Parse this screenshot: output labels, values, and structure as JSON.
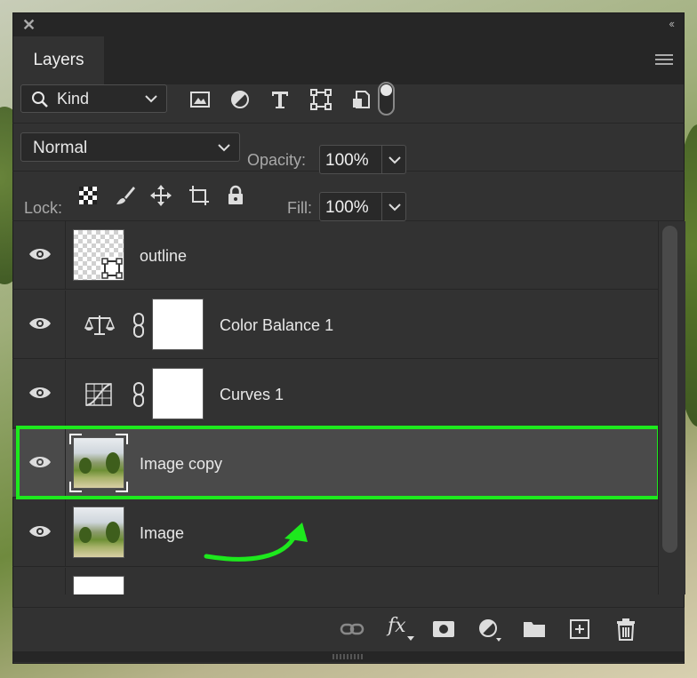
{
  "panel": {
    "close_glyph": "✕",
    "collapse_glyph": "‹‹",
    "tab_label": "Layers"
  },
  "filter": {
    "kind_label": "Kind",
    "icons": [
      "image-filter-icon",
      "adjustment-filter-icon",
      "type-filter-icon",
      "shape-filter-icon",
      "smart-object-filter-icon"
    ],
    "toggle_on": true
  },
  "blend": {
    "mode": "Normal",
    "opacity_label": "Opacity:",
    "opacity_value": "100%"
  },
  "lock": {
    "label": "Lock:",
    "fill_label": "Fill:",
    "fill_value": "100%"
  },
  "layers": [
    {
      "name": "outline",
      "type": "shape",
      "visible": true
    },
    {
      "name": "Color Balance 1",
      "type": "adjustment",
      "visible": true
    },
    {
      "name": "Curves 1",
      "type": "adjustment",
      "visible": true
    },
    {
      "name": "Image copy",
      "type": "image",
      "visible": true,
      "selected": true
    },
    {
      "name": "Image",
      "type": "image",
      "visible": true
    }
  ],
  "colors": {
    "panel_bg": "#323232",
    "selected_row": "#4a4a4a",
    "highlight": "#1de91d"
  },
  "bottom_icons": [
    "link-layers-icon",
    "fx-icon",
    "layer-mask-icon",
    "new-adjustment-icon",
    "new-group-icon",
    "new-layer-icon",
    "trash-icon"
  ],
  "fx_label": "fx"
}
